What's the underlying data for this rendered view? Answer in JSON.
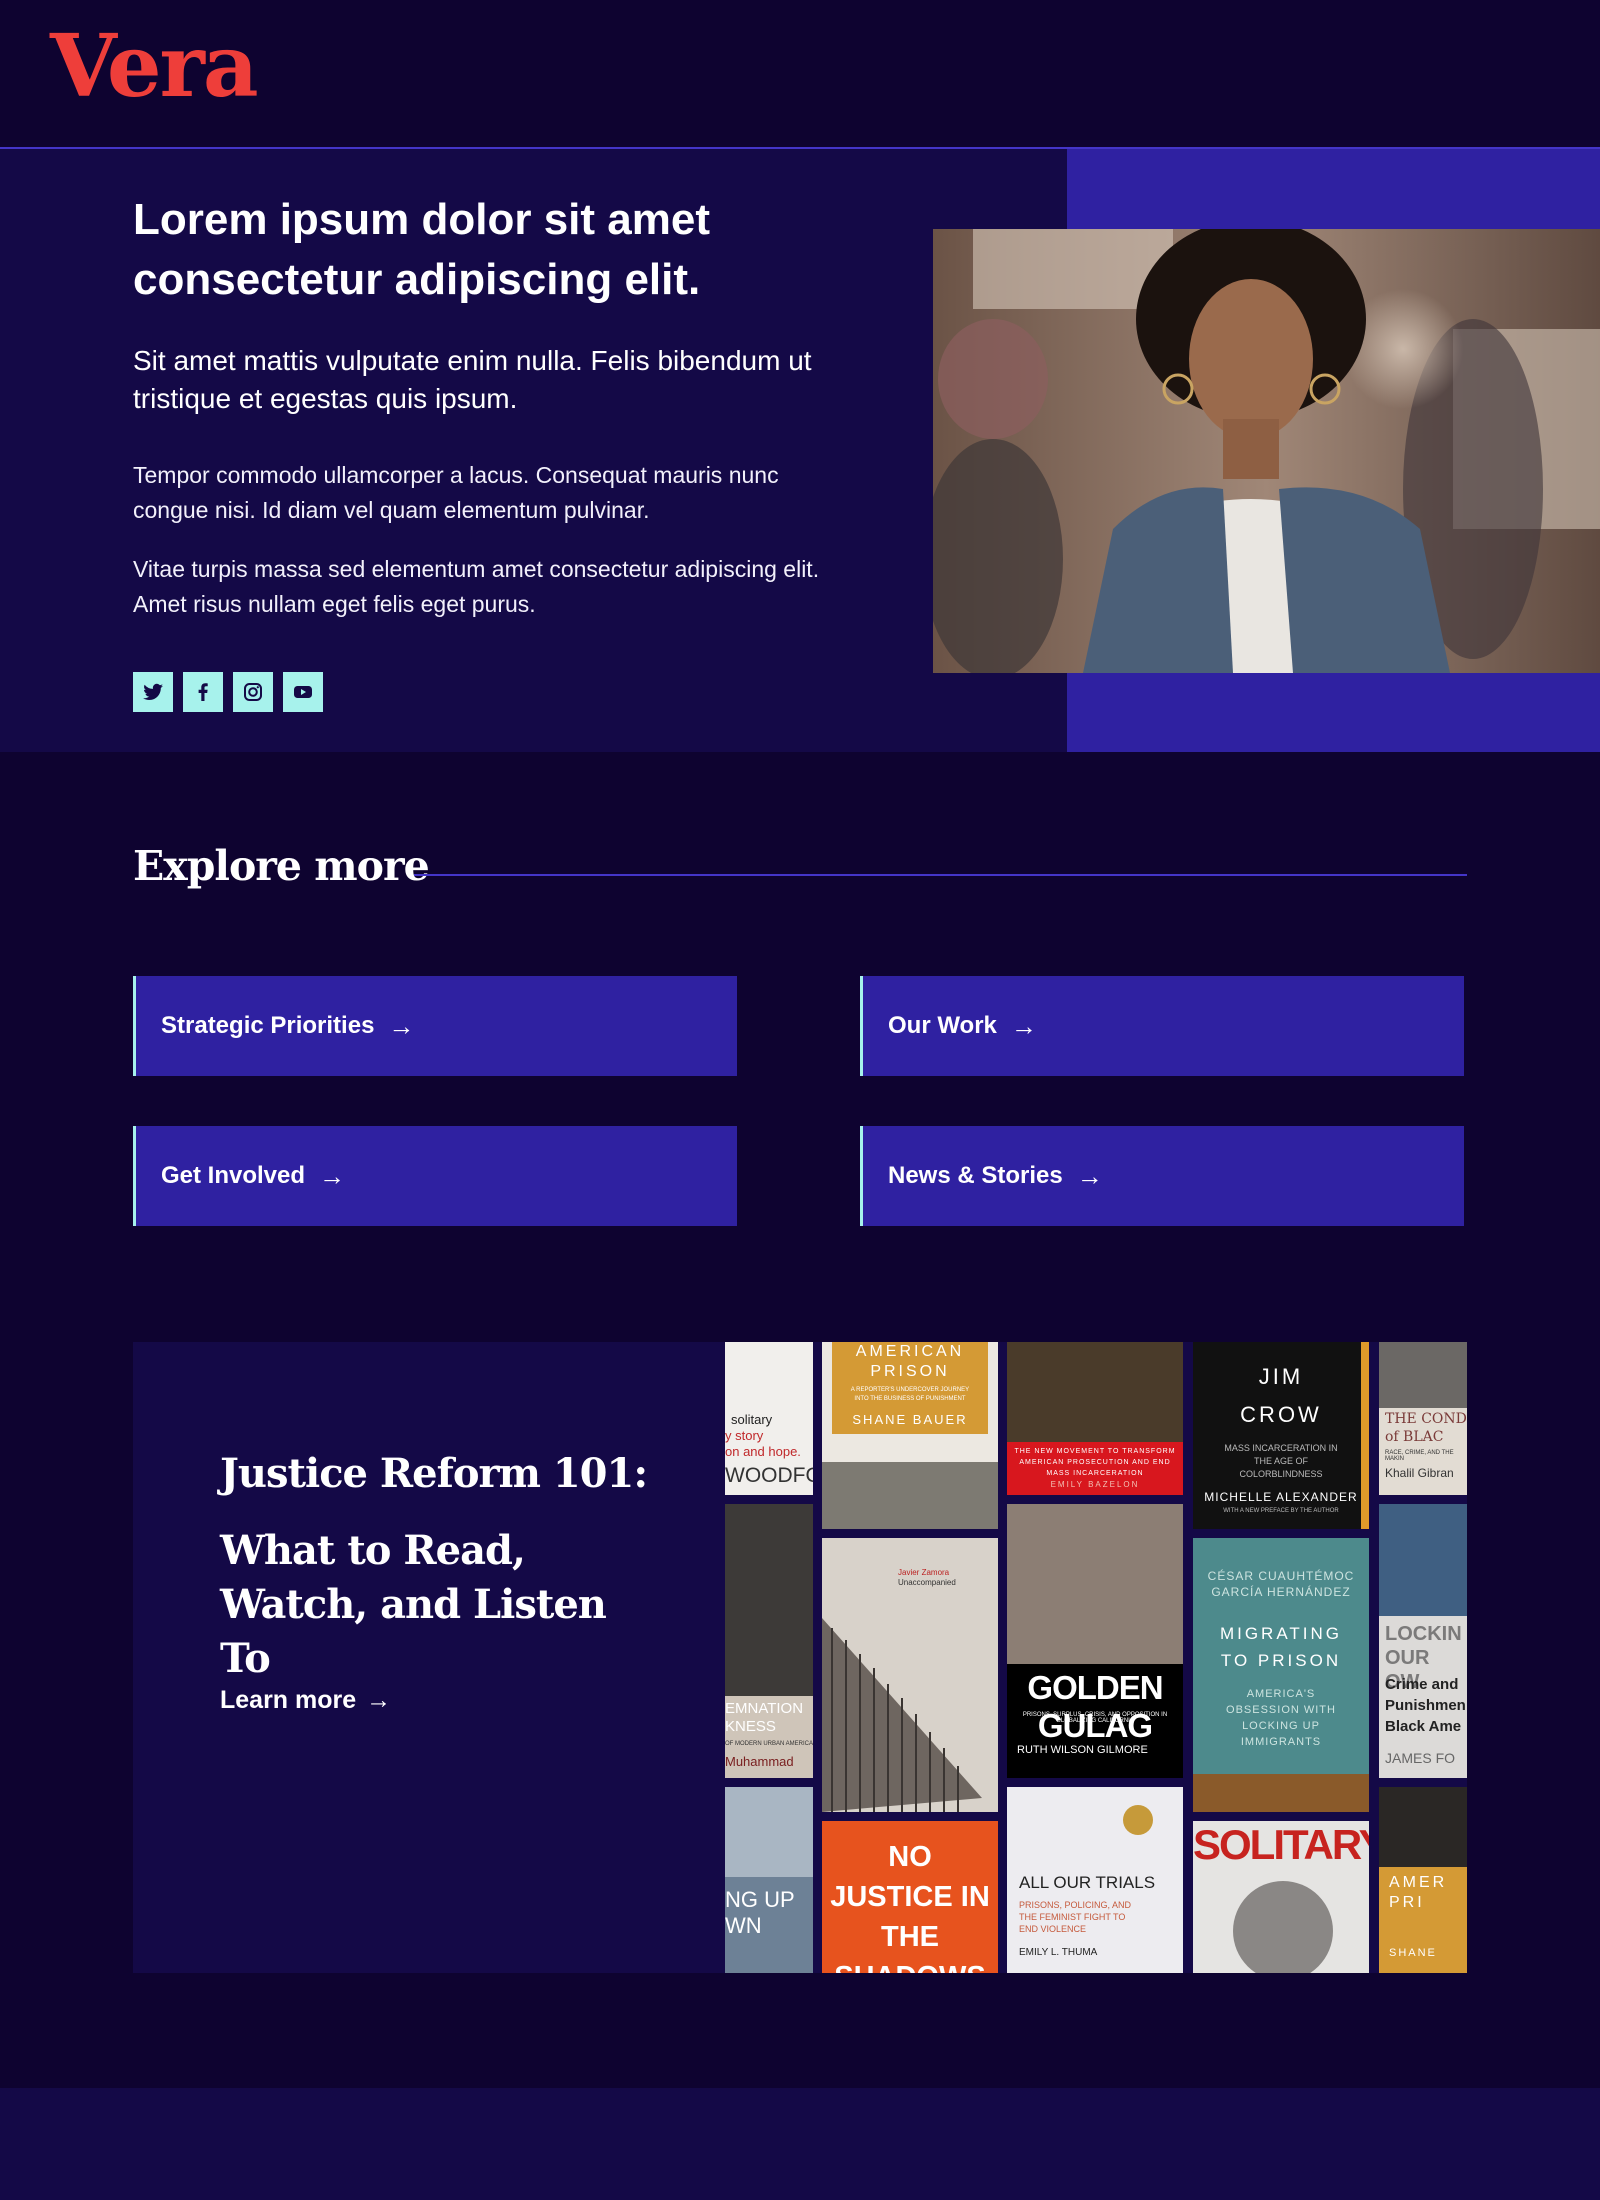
{
  "brand": {
    "logo": "Vera",
    "accent_color": "#ee3e3a"
  },
  "hero": {
    "title": "Lorem ipsum dolor sit amet consectetur adipiscing elit.",
    "lead": "Sit amet mattis vulputate enim nulla. Felis bibendum ut tristique et egestas quis ipsum.",
    "paragraph_1": "Tempor commodo ullamcorper a lacus. Consequat mauris nunc congue nisi. Id diam vel quam elementum pulvinar.",
    "paragraph_2": "Vitae turpis massa sed elementum amet consectetur adipiscing elit. Amet risus nullam eget felis eget purus.",
    "social": [
      "twitter-icon",
      "facebook-icon",
      "instagram-icon",
      "youtube-icon"
    ]
  },
  "explore": {
    "title": "Explore more",
    "links": [
      {
        "label": "Strategic Priorities",
        "arrow": "→"
      },
      {
        "label": "Our Work",
        "arrow": "→"
      },
      {
        "label": "Get Involved",
        "arrow": "→"
      },
      {
        "label": "News & Stories",
        "arrow": "→"
      }
    ]
  },
  "feature": {
    "title_line_1": "Justice Reform 101:",
    "title_line_2": "What to Read, Watch, and Listen To",
    "link_label": "Learn more",
    "link_arrow": "→",
    "books": [
      {
        "title": "solitary",
        "line2": "y story",
        "line3": "on and hope.",
        "author": "WOODFOX"
      },
      {
        "title": "AMERICAN PRISON",
        "subtitle": "A REPORTER'S UNDERCOVER JOURNEY INTO THE BUSINESS OF PUNISHMENT",
        "author": "SHANE BAUER"
      },
      {
        "title": "THE NEW MOVEMENT TO TRANSFORM AMERICAN PROSECUTION AND END MASS INCARCERATION",
        "author": "EMILY BAZELON"
      },
      {
        "title_1": "JIM",
        "title_2": "CROW",
        "subtitle": "MASS INCARCERATION IN THE AGE OF COLORBLINDNESS",
        "author": "MICHELLE ALEXANDER",
        "note": "WITH A NEW PREFACE BY THE AUTHOR"
      },
      {
        "title": "THE COND of BLAC",
        "subtitle": "RACE, CRIME, AND THE MAKIN",
        "author": "Khalil Gibran"
      },
      {
        "title": "EMNATION KNESS",
        "subtitle": "OF MODERN URBAN AMERICA",
        "author": "Muhammad"
      },
      {
        "author": "Javier Zamora",
        "title": "Unaccompanied"
      },
      {
        "title": "GOLDEN GULAG",
        "subtitle": "PRISONS, SURPLUS, CRISIS, AND OPPOSITION IN GLOBALIZING CALIFORNIA",
        "author": "RUTH WILSON GILMORE"
      },
      {
        "author": "CÉSAR CUAUHTÉMOC GARCÍA HERNÁNDEZ",
        "title": "MIGRATING TO PRISON",
        "subtitle": "AMERICA'S OBSESSION WITH LOCKING UP IMMIGRANTS"
      },
      {
        "title": "LOCKIN OUR OW",
        "subtitle": "Crime and Punishmen Black Ame",
        "author": "JAMES FO"
      },
      {
        "title": "NG UP WN"
      },
      {
        "title": "NO JUSTICE IN THE SHADOWS"
      },
      {
        "title": "ALL OUR TRIALS",
        "subtitle": "PRISONS, POLICING, AND THE FEMINIST FIGHT TO END VIOLENCE",
        "author": "EMILY L. THUMA"
      },
      {
        "title": "SOLITARY"
      },
      {
        "title": "AMER PRI",
        "author": "SHANE"
      }
    ]
  }
}
